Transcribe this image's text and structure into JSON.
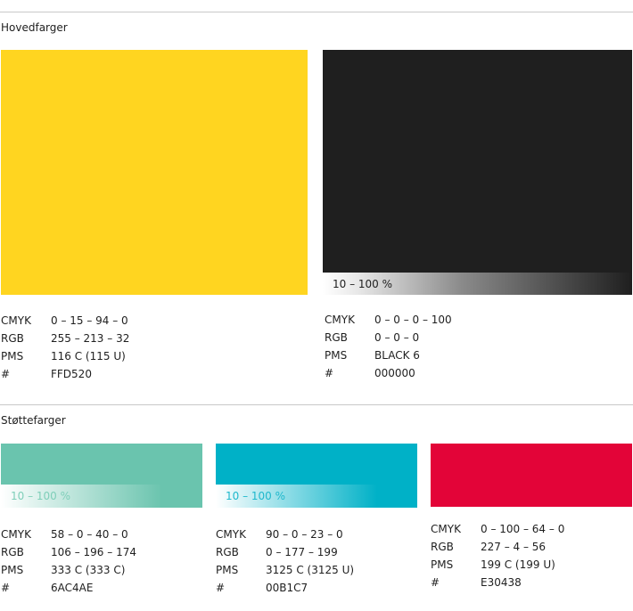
{
  "sections": {
    "main": {
      "title": "Hovedfarger",
      "colors": [
        {
          "color": "#FFD520",
          "tint_label": "",
          "specs": [
            {
              "key": "CMYK",
              "value": "0 – 15 – 94 – 0"
            },
            {
              "key": "RGB",
              "value": "255 – 213 – 32"
            },
            {
              "key": "PMS",
              "value": "116 C  (115 U)"
            },
            {
              "key": "#",
              "value": "FFD520"
            }
          ]
        },
        {
          "color": "#1F1F1F",
          "tint_label": "10 – 100 %",
          "specs": [
            {
              "key": "CMYK",
              "value": "0 – 0 – 0 – 100"
            },
            {
              "key": "RGB",
              "value": "0 – 0 – 0"
            },
            {
              "key": "PMS",
              "value": "BLACK 6"
            },
            {
              "key": "#",
              "value": "000000"
            }
          ]
        }
      ]
    },
    "support": {
      "title": "Støttefarger",
      "colors": [
        {
          "color": "#6AC4AE",
          "tint_label": "10 – 100 %",
          "specs": [
            {
              "key": "CMYK",
              "value": "58 – 0 – 40 – 0"
            },
            {
              "key": "RGB",
              "value": "106 – 196 – 174"
            },
            {
              "key": "PMS",
              "value": "333 C (333 C)"
            },
            {
              "key": "#",
              "value": "6AC4AE"
            }
          ]
        },
        {
          "color": "#00B1C7",
          "tint_label": "10 – 100 %",
          "specs": [
            {
              "key": "CMYK",
              "value": "90 – 0 – 23 – 0"
            },
            {
              "key": "RGB",
              "value": "0 – 177 – 199"
            },
            {
              "key": "PMS",
              "value": "3125 C (3125 U)"
            },
            {
              "key": "#",
              "value": "00B1C7"
            }
          ]
        },
        {
          "color": "#E30438",
          "tint_label": "",
          "specs": [
            {
              "key": "CMYK",
              "value": "0 – 100 – 64 – 0"
            },
            {
              "key": "RGB",
              "value": "227 – 4 – 56"
            },
            {
              "key": "PMS",
              "value": "199 C (199 U)"
            },
            {
              "key": "#",
              "value": "E30438"
            }
          ]
        }
      ]
    }
  }
}
